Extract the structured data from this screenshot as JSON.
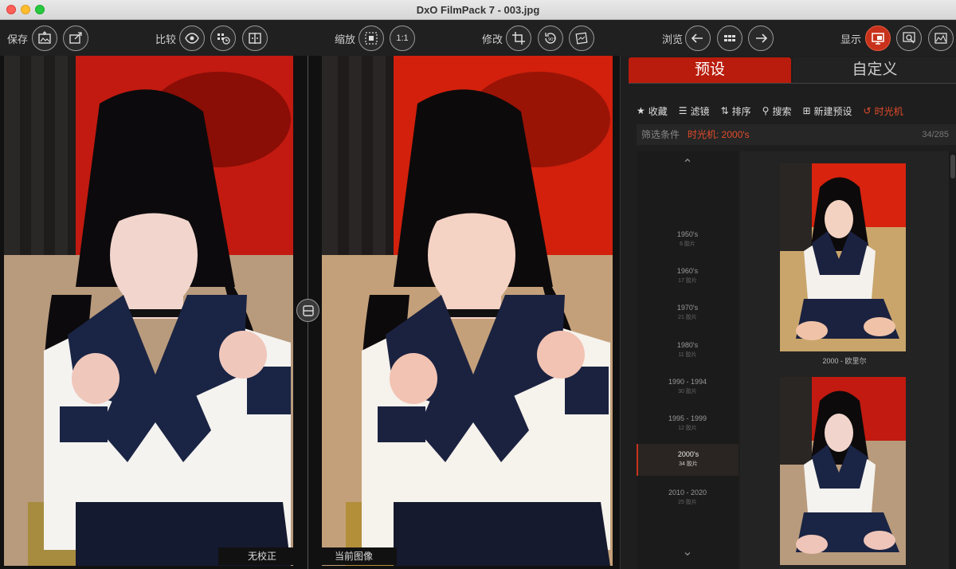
{
  "window": {
    "title": "DxO FilmPack 7 - 003.jpg"
  },
  "toolbar": {
    "save_label": "保存",
    "compare_label": "比较",
    "zoom_label": "缩放",
    "zoom_1to1": "1:1",
    "edit_label": "修改",
    "browse_label": "浏览",
    "display_label": "显示"
  },
  "canvas": {
    "left_caption": "无校正",
    "right_caption": "当前图像"
  },
  "panel": {
    "tabs": {
      "preset": "预设",
      "custom": "自定义"
    },
    "actions": {
      "favorites": "收藏",
      "filter": "滤镜",
      "sort": "排序",
      "search": "搜索",
      "new_preset": "新建预设",
      "time_machine": "时光机"
    },
    "filter": {
      "label": "筛选条件",
      "value": "时光机: 2000's",
      "count": "34/285"
    },
    "decades": [
      {
        "name": "1950's",
        "count": "6 胶片"
      },
      {
        "name": "1960's",
        "count": "17 胶片"
      },
      {
        "name": "1970's",
        "count": "21 胶片"
      },
      {
        "name": "1980's",
        "count": "11 胶片"
      },
      {
        "name": "1990 - 1994",
        "count": "30 胶片"
      },
      {
        "name": "1995 - 1999",
        "count": "12 胶片"
      },
      {
        "name": "2000's",
        "count": "34 胶片"
      },
      {
        "name": "2010 - 2020",
        "count": "25 胶片"
      }
    ],
    "thumbnails": [
      {
        "caption": "2000 - 欧里尔"
      }
    ]
  }
}
